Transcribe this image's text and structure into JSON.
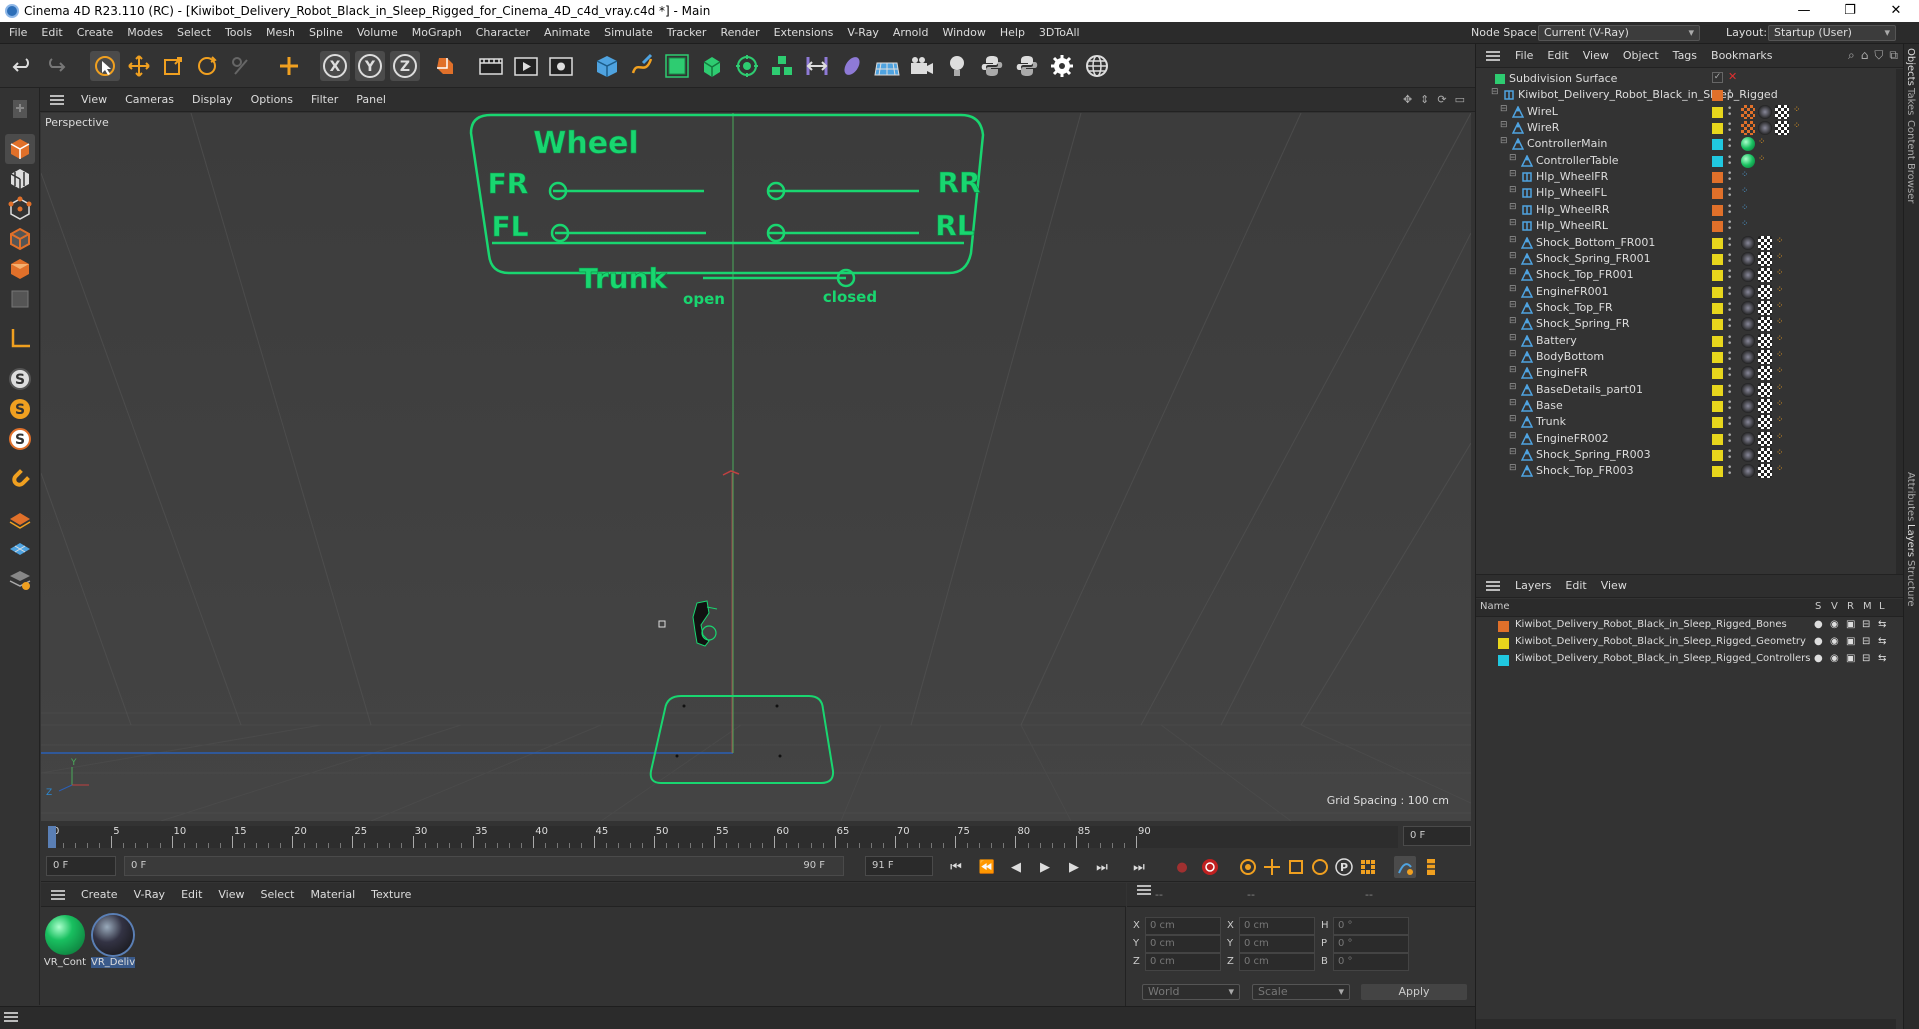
{
  "window": {
    "title": "Cinema 4D R23.110 (RC) - [Kiwibot_Delivery_Robot_Black_in_Sleep_Rigged_for_Cinema_4D_c4d_vray.c4d *] - Main",
    "minimize": "—",
    "maximize": "❐",
    "close": "✕"
  },
  "menubar": {
    "items": [
      "File",
      "Edit",
      "Create",
      "Modes",
      "Select",
      "Tools",
      "Mesh",
      "Spline",
      "Volume",
      "MoGraph",
      "Character",
      "Animate",
      "Simulate",
      "Tracker",
      "Render",
      "Extensions",
      "V-Ray",
      "Arnold",
      "Window",
      "Help",
      "3DToAll"
    ],
    "node_space_label": "Node Space:",
    "node_space_value": "Current (V-Ray)",
    "layout_label": "Layout:",
    "layout_value": "Startup (User)"
  },
  "viewport": {
    "menu": [
      "View",
      "Cameras",
      "Display",
      "Options",
      "Filter",
      "Panel"
    ],
    "name": "Perspective",
    "grid_spacing": "Grid Spacing : 100 cm",
    "controller": {
      "wheel": "Wheel",
      "fr": "FR",
      "rr": "RR",
      "fl": "FL",
      "rl": "RL",
      "trunk": "Trunk",
      "open": "open",
      "closed": "closed"
    },
    "axis_y": "Y",
    "axis_z": "Z"
  },
  "timeline": {
    "ticks": [
      "0",
      "5",
      "10",
      "15",
      "20",
      "25",
      "30",
      "35",
      "40",
      "45",
      "50",
      "55",
      "60",
      "65",
      "70",
      "75",
      "80",
      "85",
      "90"
    ],
    "current_frame": "0 F",
    "start_frame": "0 F",
    "range_start": "0 F",
    "range_end": "90 F",
    "end_frame": "91 F"
  },
  "materials": {
    "menu": [
      "Create",
      "V-Ray",
      "Edit",
      "View",
      "Select",
      "Material",
      "Texture"
    ],
    "items": [
      {
        "label": "VR_Cont",
        "color": "#19c060"
      },
      {
        "label": "VR_Deliv",
        "color": "#222a33"
      }
    ]
  },
  "coords": {
    "x": "X",
    "y": "Y",
    "z": "Z",
    "h": "H",
    "p": "P",
    "b": "B",
    "pos_value": "0 cm",
    "rot_value": "0 °",
    "header": "--",
    "world": "World",
    "scale": "Scale",
    "apply": "Apply"
  },
  "objects": {
    "menu": [
      "File",
      "Edit",
      "View",
      "Object",
      "Tags",
      "Bookmarks"
    ],
    "rows": [
      {
        "name": "Subdivision Surface",
        "indent": 0,
        "layer": "",
        "kind": "sub"
      },
      {
        "name": "Kiwibot_Delivery_Robot_Black_in_Sleep_Rigged",
        "indent": 1,
        "layer": "#e0702a",
        "kind": "null"
      },
      {
        "name": "WireL",
        "indent": 2,
        "layer": "#e8d61c",
        "kind": "bone",
        "tags": "tex"
      },
      {
        "name": "WireR",
        "indent": 2,
        "layer": "#e8d61c",
        "kind": "bone",
        "tags": "tex"
      },
      {
        "name": "ControllerMain",
        "indent": 2,
        "layer": "#20c8e0",
        "kind": "bone",
        "tags": "ctrl"
      },
      {
        "name": "ControllerTable",
        "indent": 3,
        "layer": "#20c8e0",
        "kind": "bone",
        "tags": "ctrl"
      },
      {
        "name": "Hlp_WheelFR",
        "indent": 3,
        "layer": "#e0702a",
        "kind": "null",
        "tags": "dots"
      },
      {
        "name": "Hlp_WheelFL",
        "indent": 3,
        "layer": "#e0702a",
        "kind": "null",
        "tags": "dots"
      },
      {
        "name": "Hlp_WheelRR",
        "indent": 3,
        "layer": "#e0702a",
        "kind": "null",
        "tags": "dots"
      },
      {
        "name": "Hlp_WheelRL",
        "indent": 3,
        "layer": "#e0702a",
        "kind": "null",
        "tags": "dots"
      },
      {
        "name": "Shock_Bottom_FR001",
        "indent": 3,
        "layer": "#e8d61c",
        "kind": "bone",
        "tags": "mat"
      },
      {
        "name": "Shock_Spring_FR001",
        "indent": 3,
        "layer": "#e8d61c",
        "kind": "bone",
        "tags": "mat"
      },
      {
        "name": "Shock_Top_FR001",
        "indent": 3,
        "layer": "#e8d61c",
        "kind": "bone",
        "tags": "mat"
      },
      {
        "name": "EngineFR001",
        "indent": 3,
        "layer": "#e8d61c",
        "kind": "bone",
        "tags": "mat"
      },
      {
        "name": "Shock_Top_FR",
        "indent": 3,
        "layer": "#e8d61c",
        "kind": "bone",
        "tags": "mat"
      },
      {
        "name": "Shock_Spring_FR",
        "indent": 3,
        "layer": "#e8d61c",
        "kind": "bone",
        "tags": "mat"
      },
      {
        "name": "Battery",
        "indent": 3,
        "layer": "#e8d61c",
        "kind": "bone",
        "tags": "mat"
      },
      {
        "name": "BodyBottom",
        "indent": 3,
        "layer": "#e8d61c",
        "kind": "bone",
        "tags": "mat"
      },
      {
        "name": "EngineFR",
        "indent": 3,
        "layer": "#e8d61c",
        "kind": "bone",
        "tags": "mat"
      },
      {
        "name": "BaseDetails_part01",
        "indent": 3,
        "layer": "#e8d61c",
        "kind": "bone",
        "tags": "mat"
      },
      {
        "name": "Base",
        "indent": 3,
        "layer": "#e8d61c",
        "kind": "bone",
        "tags": "mat"
      },
      {
        "name": "Trunk",
        "indent": 3,
        "layer": "#e8d61c",
        "kind": "bone",
        "tags": "mat"
      },
      {
        "name": "EngineFR002",
        "indent": 3,
        "layer": "#e8d61c",
        "kind": "bone",
        "tags": "mat"
      },
      {
        "name": "Shock_Spring_FR003",
        "indent": 3,
        "layer": "#e8d61c",
        "kind": "bone",
        "tags": "mat"
      },
      {
        "name": "Shock_Top_FR003",
        "indent": 3,
        "layer": "#e8d61c",
        "kind": "bone",
        "tags": "mat"
      }
    ]
  },
  "layers": {
    "menu": [
      "Layers",
      "Edit",
      "View"
    ],
    "header_name": "Name",
    "columns": [
      "S",
      "V",
      "R",
      "M",
      "L"
    ],
    "rows": [
      {
        "name": "Kiwibot_Delivery_Robot_Black_in_Sleep_Rigged_Bones",
        "color": "#e0702a"
      },
      {
        "name": "Kiwibot_Delivery_Robot_Black_in_Sleep_Rigged_Geometry",
        "color": "#e8d61c"
      },
      {
        "name": "Kiwibot_Delivery_Robot_Black_in_Sleep_Rigged_Controllers",
        "color": "#20c8e0"
      }
    ]
  },
  "side_tabs": [
    "Objects",
    "Takes",
    "Content Browser",
    "Attributes",
    "Layers",
    "Structure"
  ],
  "colors": {
    "accent": "#f0a020",
    "controller": "#19d670",
    "selection": "#5a7fb5"
  }
}
